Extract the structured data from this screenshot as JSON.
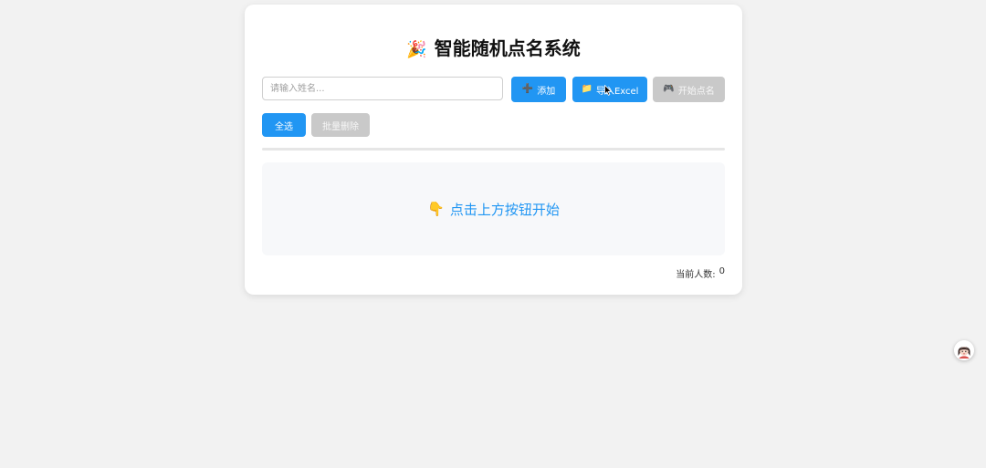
{
  "app": {
    "title": "智能随机点名系统",
    "title_icon": "🎉"
  },
  "toolbar": {
    "name_input_placeholder": "请输入姓名...",
    "name_input_value": "",
    "add_icon": "➕",
    "add_label": "添加",
    "import_icon": "📁",
    "import_label": "导入Excel",
    "start_icon": "🎮",
    "start_label": "开始点名"
  },
  "actions": {
    "select_all_label": "全选",
    "batch_delete_label": "批量删除"
  },
  "empty_state": {
    "icon": "👇",
    "text": "点击上方按钮开始"
  },
  "footer": {
    "count_label": "当前人数:",
    "count_value": "0"
  },
  "colors": {
    "accent": "#2196f3",
    "disabled": "#c9c9c9"
  },
  "icons": {
    "assistant": "assistant-avatar-icon",
    "cursor": "mouse-cursor-icon"
  }
}
